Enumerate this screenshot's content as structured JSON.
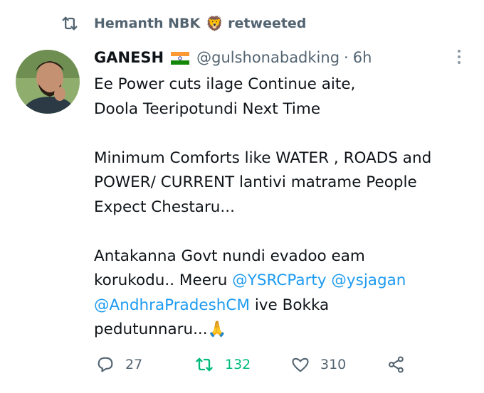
{
  "retweet": {
    "user": "Hemanth NBK",
    "emoji": "🦁",
    "label": "retweeted",
    "icon": "retweet-icon"
  },
  "tweet": {
    "name": "GANESH",
    "flag": "india-flag-icon",
    "handle": "@gulshonabadking",
    "dot": "·",
    "time": "6h",
    "lines": {
      "l1": "Ee Power cuts ilage Continue aite,",
      "l2": "Doola Teeripotundi Next Time",
      "l3": "Minimum Comforts like WATER , ROADS and",
      "l4": "POWER/ CURRENT lantivi matrame People",
      "l5": "Expect Chestaru...",
      "l6": "Antakanna Govt nundi evadoo eam",
      "l7a": "korukodu.. Meeru ",
      "m1": "@YSRCParty",
      "m2": "@ysjagan",
      "m3": "@AndhraPradeshCM",
      "l8b": " ive Bokka",
      "l9": "pedutunnaru...",
      "l9emoji": "🙏"
    }
  },
  "actions": {
    "reply_count": "27",
    "retweet_count": "132",
    "like_count": "310"
  },
  "colors": {
    "accent": "#1d9bf0",
    "retweet": "#00ba7c",
    "muted": "#536471"
  }
}
